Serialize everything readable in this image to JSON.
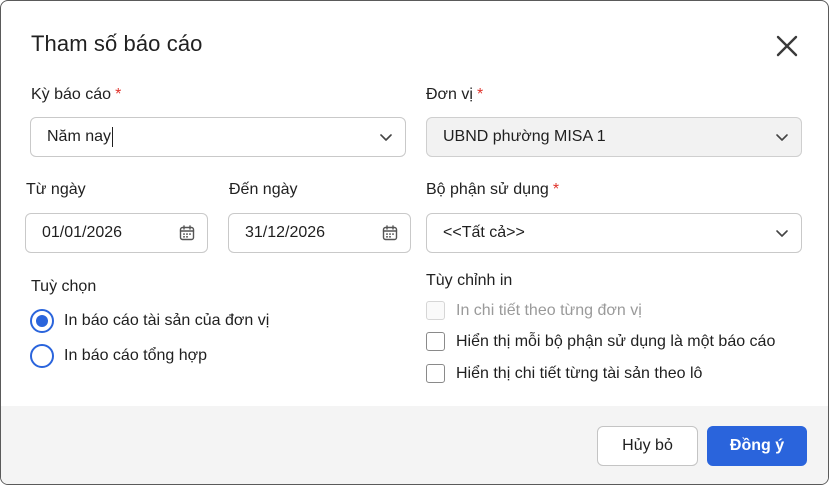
{
  "dialog": {
    "title": "Tham số báo cáo",
    "close_icon": "close-icon"
  },
  "fields": {
    "period": {
      "label": "Kỳ báo cáo",
      "required": "*",
      "value": "Năm nay"
    },
    "unit": {
      "label": "Đơn vị",
      "required": "*",
      "value": "UBND phường MISA 1"
    },
    "from_date": {
      "label": "Từ ngày",
      "value": "01/01/2026"
    },
    "to_date": {
      "label": "Đến ngày",
      "value": "31/12/2026"
    },
    "department": {
      "label": "Bộ phận sử dụng",
      "required": "*",
      "value": "<<Tất cả>>"
    }
  },
  "options": {
    "label": "Tuỳ chọn",
    "items": [
      {
        "label": "In báo cáo tài sản của đơn vị",
        "selected": true
      },
      {
        "label": "In báo cáo tổng hợp",
        "selected": false
      }
    ]
  },
  "print_options": {
    "label": "Tùy chỉnh in",
    "items": [
      {
        "label": "In chi tiết theo từng đơn vị",
        "checked": false,
        "disabled": true
      },
      {
        "label": "Hiển thị mỗi bộ phận sử dụng là một báo cáo",
        "checked": false,
        "disabled": false
      },
      {
        "label": "Hiển thị chi tiết từng tài sản theo lô",
        "checked": false,
        "disabled": false
      }
    ]
  },
  "footer": {
    "cancel_label": "Hủy bỏ",
    "ok_label": "Đồng ý"
  },
  "colors": {
    "primary": "#2a64dc",
    "required": "#e0322b",
    "footer_bg": "#f4f4f4"
  }
}
